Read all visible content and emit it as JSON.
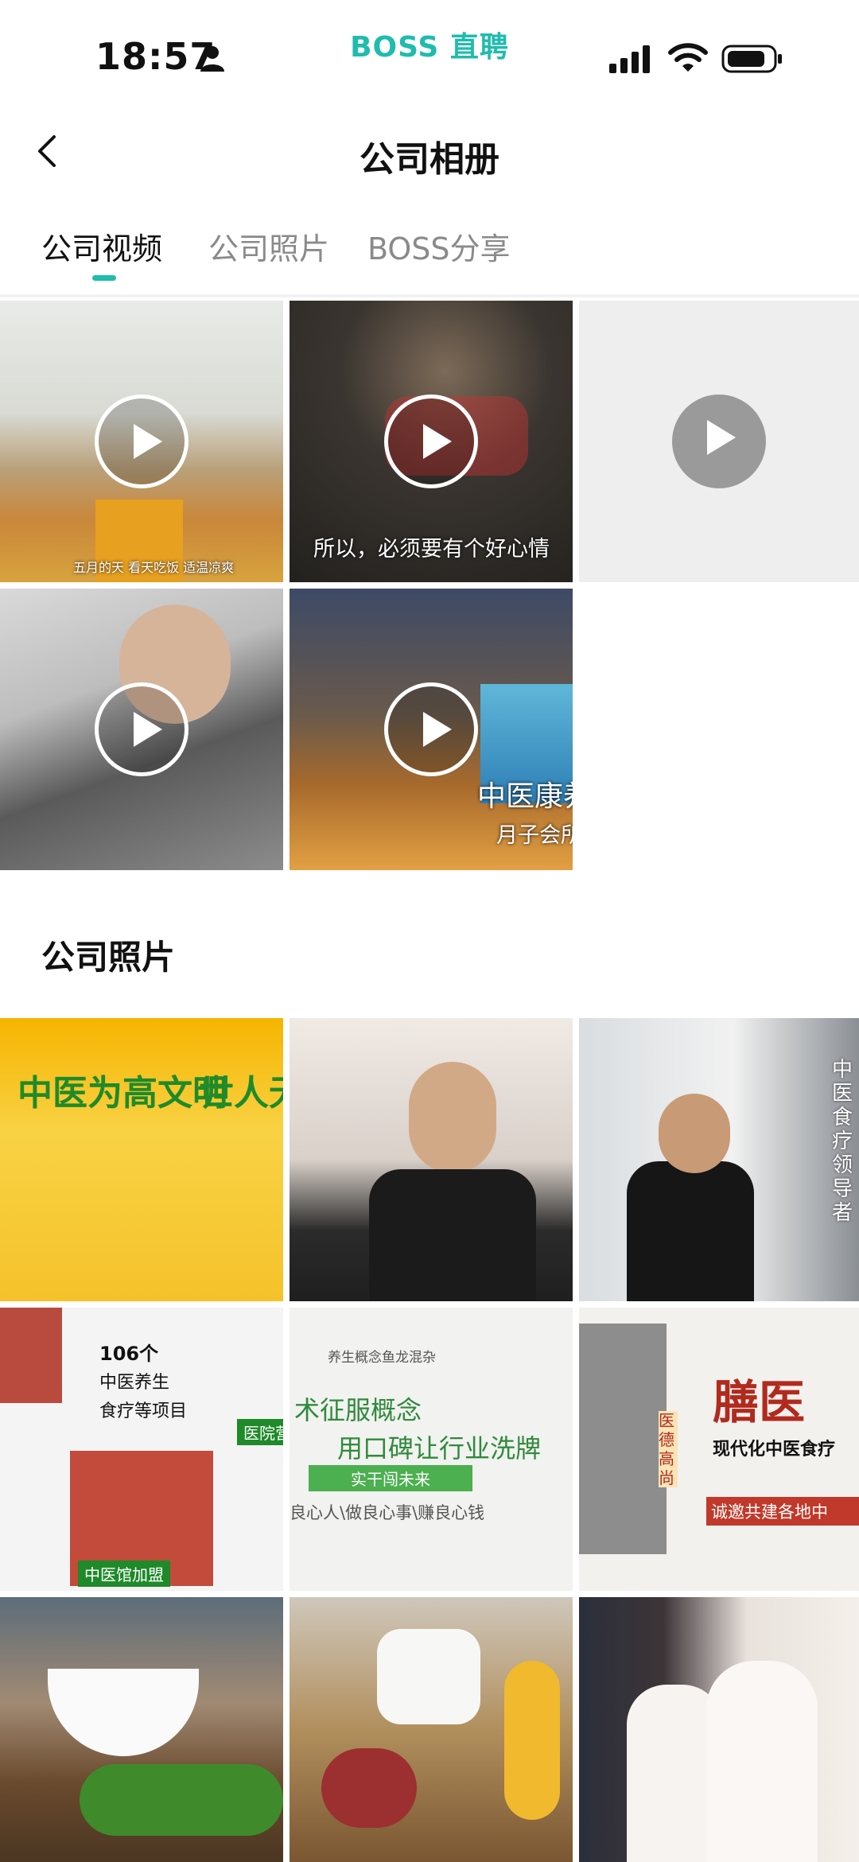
{
  "status_bar": {
    "time": "18:57",
    "brand": "BOSS 直聘"
  },
  "nav": {
    "title": "公司相册"
  },
  "tabs": [
    {
      "label": "公司视频",
      "active": true
    },
    {
      "label": "公司照片",
      "active": false
    },
    {
      "label": "BOSS分享",
      "active": false
    }
  ],
  "accent_color": "#1fbcae",
  "videos": [
    {
      "caption": "五月的天 看天吃饭 适温凉爽"
    },
    {
      "caption": "所以，必须要有个好心情"
    },
    {
      "caption": ""
    },
    {
      "caption": ""
    },
    {
      "caption": "中医康养",
      "caption2": "月子会所"
    }
  ],
  "photos_section": {
    "title": "公司照片"
  },
  "photos": [
    {
      "text1": "中医为高文明",
      "text2": "世人无"
    },
    {
      "text1": ""
    },
    {
      "text1": "中医食疗领导者"
    },
    {
      "text1": "106个",
      "text2": "中医养生",
      "text3": "食疗等项目",
      "text4": "中医馆加盟",
      "text5": "医院营"
    },
    {
      "text1": "养生概念鱼龙混杂",
      "text2": "术征服概念",
      "text3": "用口碑让行业洗牌",
      "text4": "实干闯未来",
      "text5": "良心人\\做良心事\\赚良心钱"
    },
    {
      "text1": "膳医",
      "text2": "现代化中医食疗",
      "text3": "诚邀共建各地中",
      "text4": "医德高尚"
    },
    {
      "text1": ""
    },
    {
      "text1": ""
    },
    {
      "text1": ""
    }
  ]
}
